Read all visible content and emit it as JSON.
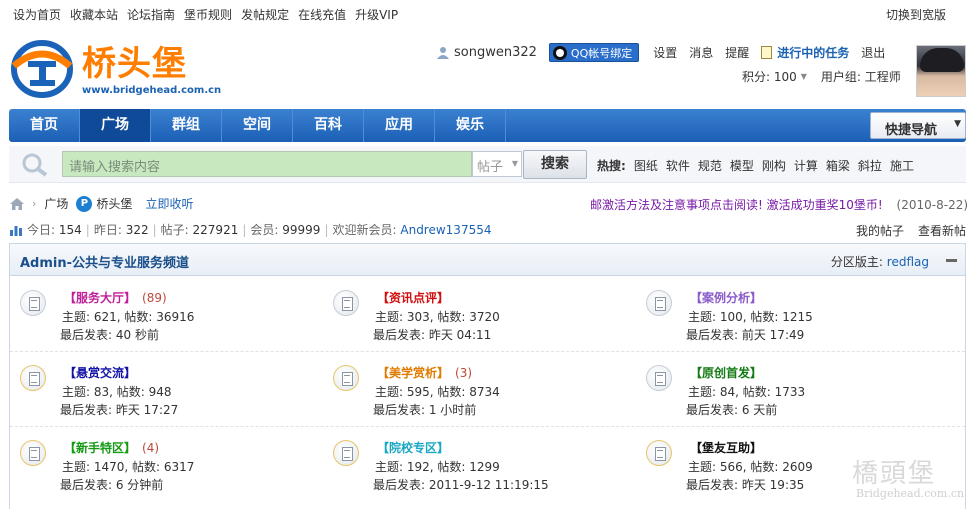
{
  "top_links": [
    "设为首页",
    "收藏本站",
    "论坛指南",
    "堡币规则",
    "发帖规定",
    "在线充值",
    "升级VIP"
  ],
  "switch_wide": "切换到宽版",
  "logo": {
    "name": "桥头堡",
    "url": "www.bridgehead.com.cn"
  },
  "user": {
    "username": "songwen322",
    "qq_bind": "QQ帐号绑定",
    "links": [
      "设置",
      "消息",
      "提醒"
    ],
    "task": "进行中的任务",
    "logout": "退出",
    "score": "积分: 100",
    "group": "用户组: 工程师"
  },
  "nav": {
    "items": [
      "首页",
      "广场",
      "群组",
      "空间",
      "百科",
      "应用",
      "娱乐"
    ],
    "active": "广场",
    "quick_nav": "快捷导航"
  },
  "search": {
    "placeholder": "请输入搜索内容",
    "type": "帖子",
    "button": "搜索",
    "hot_label": "热搜:",
    "hot_words": [
      "图纸",
      "软件",
      "规范",
      "模型",
      "刚构",
      "计算",
      "箱梁",
      "斜拉",
      "施工"
    ]
  },
  "breadcrumb": {
    "section": "广场",
    "site": "桥头堡",
    "follow": "立即收听"
  },
  "notice": {
    "message": "邮激活方法及注意事项点击阅读! 激活成功重奖10堡币!",
    "date": "(2010-8-22)"
  },
  "stats": {
    "today_label": "今日:",
    "today": "154",
    "yesterday_label": "昨日:",
    "yesterday": "322",
    "posts_label": "帖子:",
    "posts": "227921",
    "members_label": "会员:",
    "members": "99999",
    "welcome_label": "欢迎新会员:",
    "newest": "Andrew137554"
  },
  "my_links": [
    "我的帖子",
    "查看新帖"
  ],
  "category": {
    "title": "Admin-公共与专业服务频道",
    "moderator_label": "分区版主:",
    "moderator": "redflag"
  },
  "forums": [
    {
      "name": "【服务大厅】",
      "count": "(89)",
      "color": "#c0219a",
      "stat": "主题: 621, 帖数: 36916",
      "last": "最后发表: 40 秒前",
      "icon": "forum-icon"
    },
    {
      "name": "【资讯点评】",
      "count": "",
      "color": "#d10d0d",
      "stat": "主题: 303, 帖数: 3720",
      "last": "最后发表: 昨天 04:11",
      "icon": "forum-icon"
    },
    {
      "name": "【案例分析】",
      "count": "",
      "color": "#8a5bc9",
      "stat": "主题: 100, 帖数: 1215",
      "last": "最后发表: 前天 17:49",
      "icon": "forum-icon"
    },
    {
      "name": "【悬赏交流】",
      "count": "",
      "color": "#1212a8",
      "stat": "主题: 83, 帖数: 948",
      "last": "最后发表: 昨天 17:27",
      "icon": "forum-icon"
    },
    {
      "name": "【美学赏析】",
      "count": "(3)",
      "color": "#e07b00",
      "stat": "主题: 595, 帖数: 8734",
      "last": "最后发表: 1 小时前",
      "icon": "forum-icon"
    },
    {
      "name": "【原创首发】",
      "count": "",
      "color": "#147a14",
      "stat": "主题: 84, 帖数: 1733",
      "last": "最后发表: 6 天前",
      "icon": "forum-icon"
    },
    {
      "name": "【新手特区】",
      "count": "(4)",
      "color": "#149a14",
      "stat": "主题: 1470, 帖数: 6317",
      "last": "最后发表: 6 分钟前",
      "icon": "forum-icon"
    },
    {
      "name": "【院校专区】",
      "count": "",
      "color": "#18a7c4",
      "stat": "主题: 192, 帖数: 1299",
      "last": "最后发表: 2011-9-12 11:19:15",
      "icon": "forum-icon"
    },
    {
      "name": "【堡友互助】",
      "count": "",
      "color": "#111111",
      "stat": "主题: 566, 帖数: 2609",
      "last": "最后发表: 昨天 19:35",
      "icon": "forum-icon"
    }
  ],
  "watermark": {
    "title": "橋頭堡",
    "url": "Bridgehead.com.cn"
  }
}
